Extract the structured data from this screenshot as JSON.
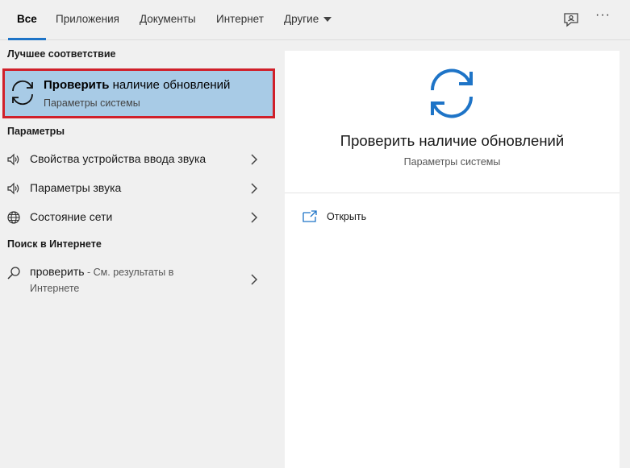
{
  "tabs": [
    {
      "label": "Все"
    },
    {
      "label": "Приложения"
    },
    {
      "label": "Документы"
    },
    {
      "label": "Интернет"
    },
    {
      "label": "Другие"
    }
  ],
  "toolbar": {
    "more_label": "···",
    "feedback_icon": "feedback-icon"
  },
  "best_match": {
    "header": "Лучшее соответствие",
    "title_bold": "Проверить",
    "title_rest": " наличие обновлений",
    "subtitle": "Параметры системы",
    "icon": "sync-icon"
  },
  "settings": {
    "header": "Параметры",
    "items": [
      {
        "label": "Свойства устройства ввода звука",
        "icon": "speaker-icon"
      },
      {
        "label": "Параметры звука",
        "icon": "speaker-icon"
      },
      {
        "label": "Состояние сети",
        "icon": "globe-icon"
      }
    ]
  },
  "web": {
    "header": "Поиск в Интернете",
    "query": "проверить",
    "suffix": " - См. результаты в",
    "suffix_line2": "Интернете",
    "icon": "search-icon"
  },
  "detail": {
    "title": "Проверить наличие обновлений",
    "subtitle": "Параметры системы",
    "action_label": "Открыть",
    "action_icon": "open-icon"
  },
  "colors": {
    "accent": "#1e74c7",
    "highlight": "#a8cbe6",
    "focus_border": "#d0202a"
  }
}
